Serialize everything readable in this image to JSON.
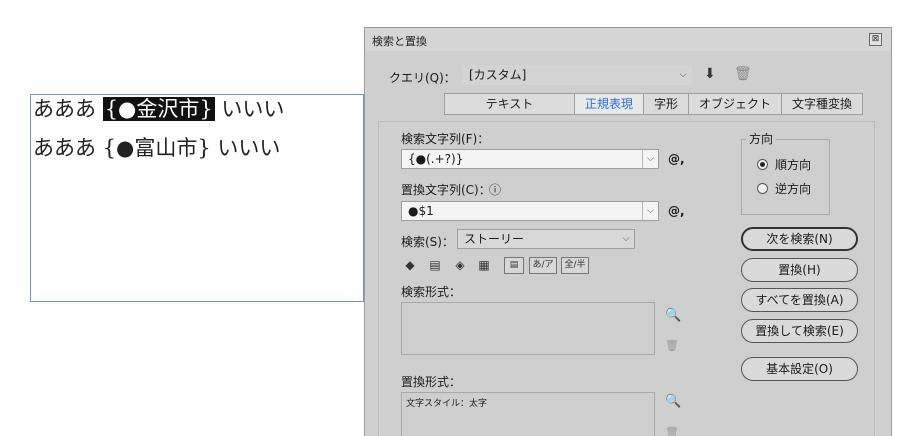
{
  "document": {
    "line1": {
      "prefix": "あああ ",
      "highlight": "{●金沢市}",
      "suffix": " いいい"
    },
    "line2": {
      "text": "あああ {●富山市} いいい"
    }
  },
  "dialog": {
    "title": "検索と置換",
    "close": "⊠",
    "query": {
      "label": "クエリ(Q)：",
      "value": "[カスタム]"
    },
    "tabs": [
      "テキスト",
      "正規表現",
      "字形",
      "オブジェクト",
      "文字種変換"
    ],
    "active_tab": "正規表現",
    "find": {
      "label": "検索文字列(F)：",
      "value": "{●(.+?)}",
      "special": "@,"
    },
    "replace": {
      "label": "置換文字列(C)：",
      "info": "ⓘ",
      "value": "●$1",
      "special": "@,"
    },
    "search": {
      "label": "検索(S)：",
      "value": "ストーリー"
    },
    "direction": {
      "title": "方向",
      "forward": "順方向",
      "backward": "逆方向",
      "selected": "順方向"
    },
    "buttons": {
      "find_next": "次を検索(N)",
      "replace": "置換(H)",
      "replace_all": "すべてを置換(A)",
      "replace_find": "置換して検索(E)",
      "basic": "基本設定(O)"
    },
    "option_icons": [
      "lock-layers",
      "lock-stories",
      "hidden-layers",
      "master-pages",
      "footnotes",
      "あ/ア",
      "全/半"
    ],
    "find_format": {
      "label": "検索形式："
    },
    "replace_format": {
      "label": "置換形式：",
      "value": "文字スタイル：太字"
    }
  },
  "colors": {
    "dialog_bg": "#cfcfcf",
    "active_tab": "#2c6fd0",
    "frame_border": "#6f95c8"
  }
}
